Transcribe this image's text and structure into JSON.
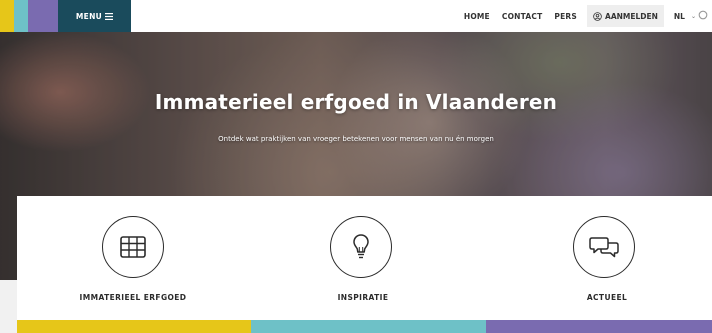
{
  "colors": {
    "stripe_yellow": "#e6c619",
    "stripe_teal": "#6ec1c7",
    "stripe_purple": "#7a6bb0",
    "menu_bg": "#1a4b5c",
    "bottom_yellow": "#e6c619",
    "bottom_teal": "#6ec1c7",
    "bottom_purple": "#7a6bb0"
  },
  "header": {
    "menu_label": "MENU",
    "menu_icon": "hamburger-icon",
    "nav": {
      "home": "HOME",
      "contact": "CONTACT",
      "pers": "PERS",
      "login": "AANMELDEN",
      "login_icon": "user-circle-icon",
      "language": "NL",
      "language_icon": "chevron-down-icon",
      "search_icon": "search-icon"
    }
  },
  "hero": {
    "title": "Immaterieel erfgoed in Vlaanderen",
    "subtitle": "Ontdek wat praktijken van vroeger betekenen voor mensen van nu én morgen"
  },
  "cards": [
    {
      "label": "IMMATERIEEL ERFGOED",
      "icon": "grid-table-icon"
    },
    {
      "label": "INSPIRATIE",
      "icon": "lightbulb-icon"
    },
    {
      "label": "ACTUEEL",
      "icon": "chat-bubbles-icon"
    }
  ]
}
